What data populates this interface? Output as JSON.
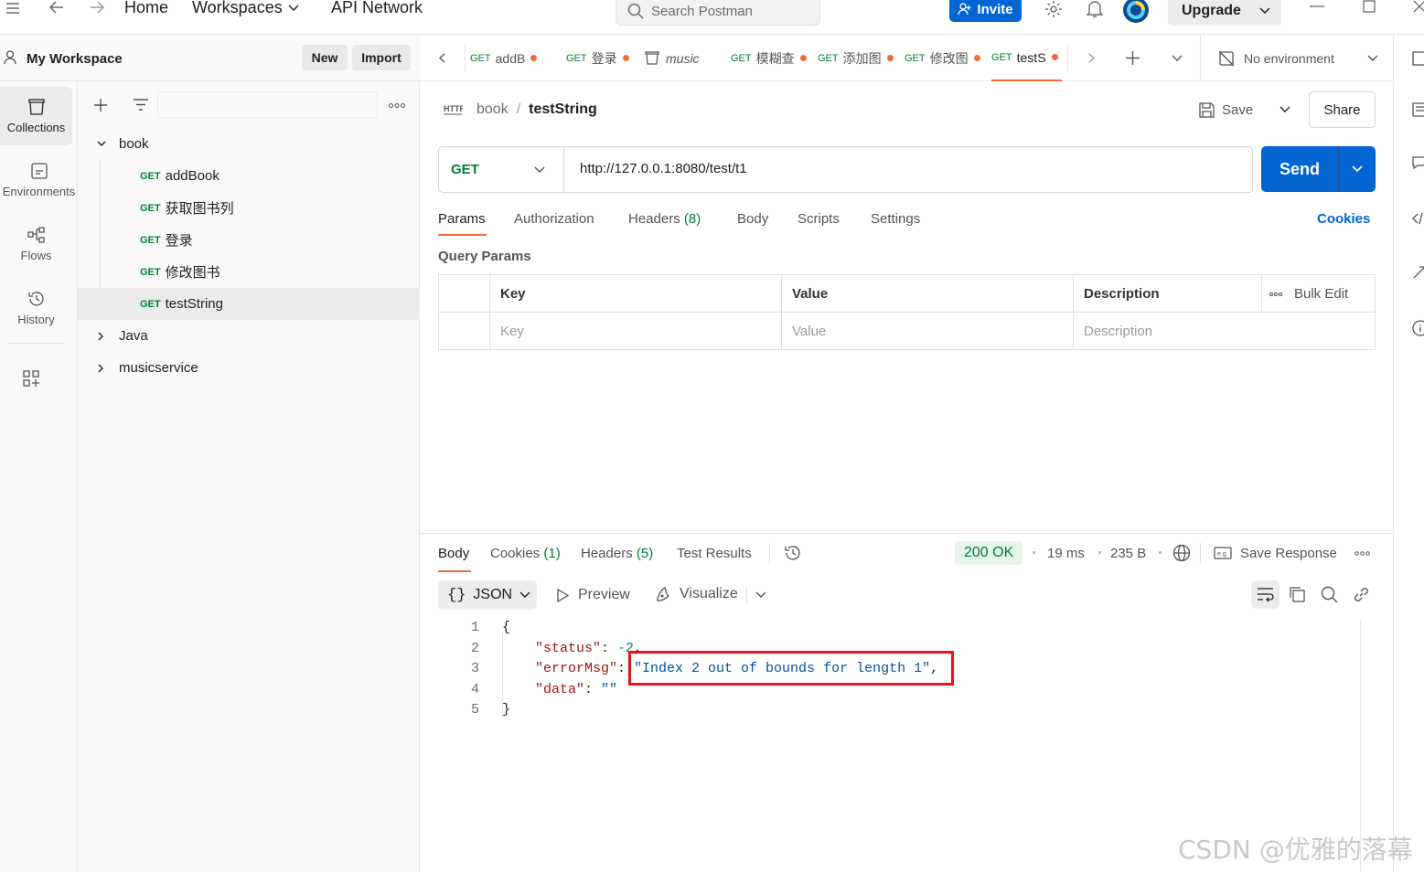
{
  "topbar": {
    "home": "Home",
    "workspaces": "Workspaces",
    "api_network": "API Network",
    "search_placeholder": "Search Postman",
    "invite": "Invite",
    "upgrade": "Upgrade"
  },
  "workspace": {
    "title": "My Workspace",
    "new_label": "New",
    "import_label": "Import"
  },
  "rail": {
    "collections": "Collections",
    "environments": "Environments",
    "flows": "Flows",
    "history": "History"
  },
  "tree": {
    "folder_book": "book",
    "items": [
      {
        "method": "GET",
        "name": "addBook"
      },
      {
        "method": "GET",
        "name": "获取图书列"
      },
      {
        "method": "GET",
        "name": "登录"
      },
      {
        "method": "GET",
        "name": "修改图书"
      },
      {
        "method": "GET",
        "name": "testString"
      }
    ],
    "folder_java": "Java",
    "folder_music": "musicservice"
  },
  "tabs": [
    {
      "method": "GET",
      "name": "addB"
    },
    {
      "method": "GET",
      "name": "登录"
    },
    {
      "method": "",
      "name": "music"
    },
    {
      "method": "GET",
      "name": "模糊查"
    },
    {
      "method": "GET",
      "name": "添加图"
    },
    {
      "method": "GET",
      "name": "修改图"
    },
    {
      "method": "GET",
      "name": "testS"
    }
  ],
  "environment": "No environment",
  "request": {
    "breadcrumb_parent": "book",
    "breadcrumb_sep": "/",
    "name": "testString",
    "save": "Save",
    "share": "Share",
    "method": "GET",
    "url": "http://127.0.0.1:8080/test/t1",
    "send": "Send",
    "subtabs": {
      "params": "Params",
      "authorization": "Authorization",
      "headers": "Headers",
      "headers_count": "(8)",
      "body": "Body",
      "scripts": "Scripts",
      "settings": "Settings",
      "cookies": "Cookies"
    },
    "query_params_title": "Query Params",
    "table": {
      "key": "Key",
      "value": "Value",
      "description": "Description",
      "bulk_edit": "Bulk Edit",
      "key_placeholder": "Key",
      "value_placeholder": "Value",
      "description_placeholder": "Description"
    }
  },
  "response": {
    "body": "Body",
    "cookies": "Cookies",
    "cookies_count": "(1)",
    "headers": "Headers",
    "headers_count": "(5)",
    "test_results": "Test Results",
    "status": "200 OK",
    "time": "19 ms",
    "size": "235 B",
    "save_response": "Save Response",
    "format": "JSON",
    "preview": "Preview",
    "visualize": "Visualize",
    "lines": [
      {
        "n": "1",
        "open": "{"
      },
      {
        "n": "2",
        "key": "\"status\"",
        "colon": ": ",
        "value": "-2",
        "comma": ","
      },
      {
        "n": "3",
        "key": "\"errorMsg\"",
        "colon": ": ",
        "value": "\"Index 2 out of bounds for length 1\"",
        "comma": ","
      },
      {
        "n": "4",
        "key": "\"data\"",
        "colon": ": ",
        "value": "\"\"",
        "comma": ""
      },
      {
        "n": "5",
        "close": "}"
      }
    ]
  },
  "watermark": "CSDN @优雅的落幕",
  "colors": {
    "accent": "#0265d2",
    "get": "#007f31",
    "tab_dot": "#f26b3a",
    "highlight_box": "#e8141c",
    "status_ok_bg": "#e6f5ea"
  }
}
